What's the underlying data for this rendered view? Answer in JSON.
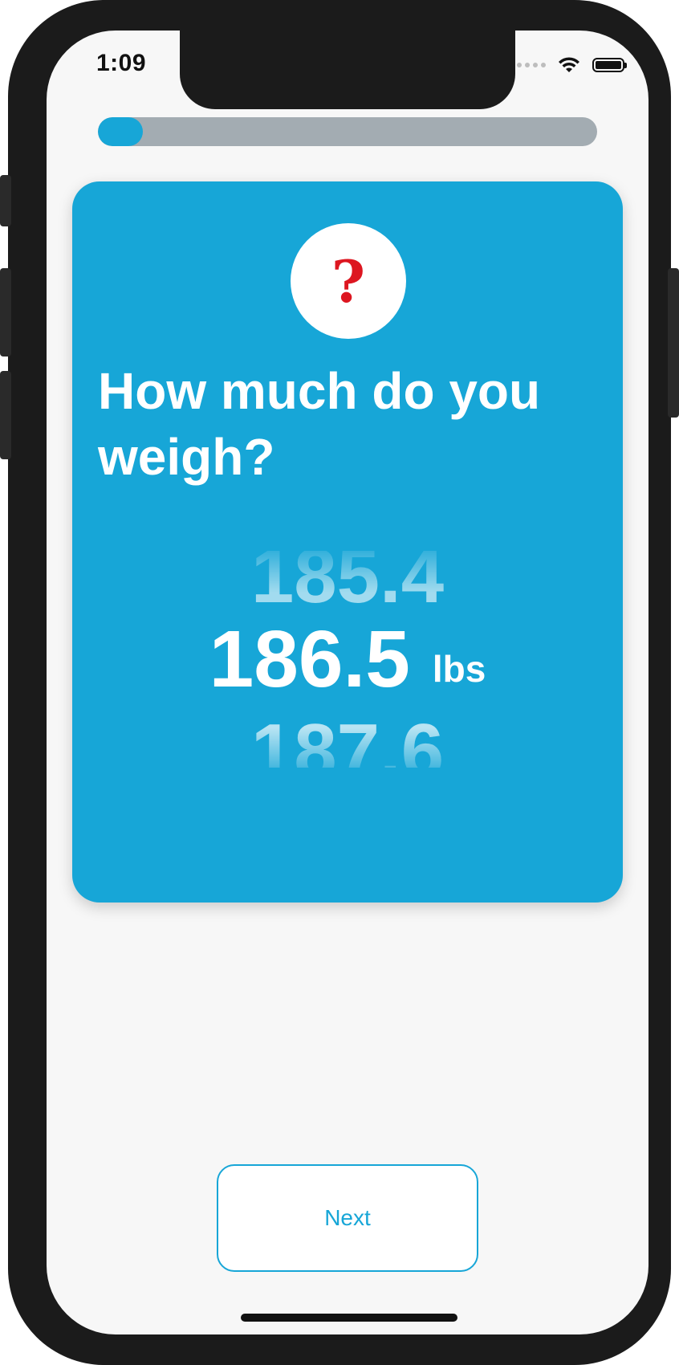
{
  "status_bar": {
    "time": "1:09",
    "icons": [
      "cellular-signal-icon",
      "wifi-icon",
      "battery-icon"
    ]
  },
  "progress": {
    "fraction": 0.09,
    "color": "#17a6d7",
    "track_color": "#a3acb2"
  },
  "card": {
    "background": "#17a6d7",
    "icon": "question-mark-icon",
    "icon_glyph": "?",
    "icon_color": "#dd1620",
    "question": "How much do you weigh?"
  },
  "picker": {
    "previous_value": "185.4",
    "selected_value": "186.5",
    "next_value": "187.6",
    "unit": "lbs"
  },
  "footer": {
    "next_label": "Next"
  }
}
